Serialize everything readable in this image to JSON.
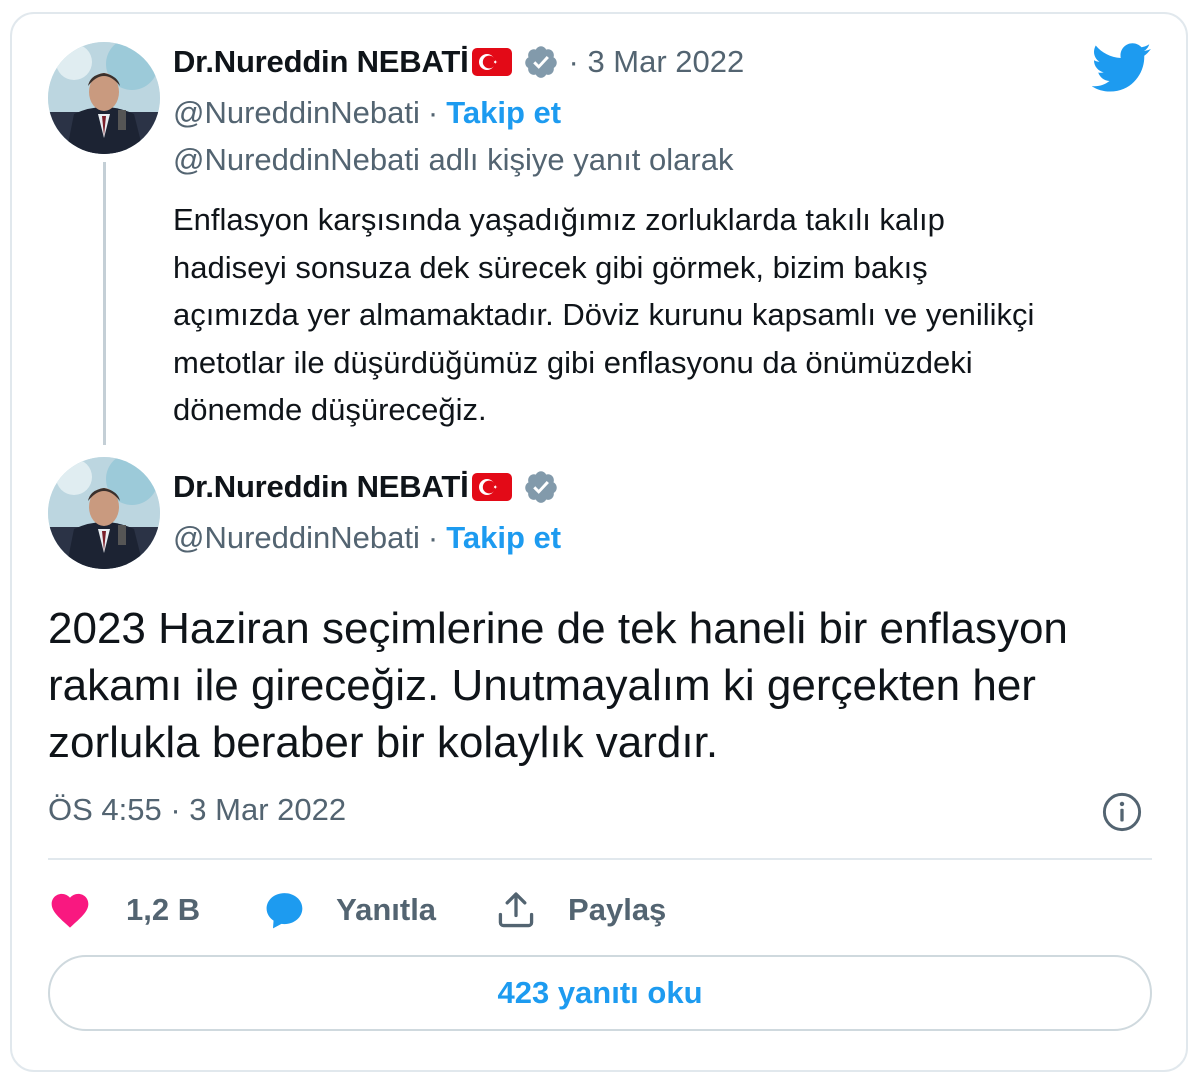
{
  "colors": {
    "accent": "#1d9bf0",
    "text_primary": "#0f1419",
    "text_secondary": "#536471",
    "like": "#f91880",
    "border": "#e1e8ed"
  },
  "icons": {
    "brand": "twitter-bird-icon",
    "flag": "turkey-flag-icon",
    "verified": "verified-badge-icon",
    "info": "info-icon",
    "like": "heart-icon",
    "reply": "chat-bubble-icon",
    "share": "share-upload-icon"
  },
  "parent_tweet": {
    "display_name": "Dr.Nureddin NEBATİ",
    "date": "· 3 Mar 2022",
    "handle": "@NureddinNebati",
    "separator": "·",
    "follow_label": "Takip et",
    "reply_context": "@NureddinNebati adlı kişiye yanıt olarak",
    "text_lines": [
      "Enflasyon karşısında yaşadığımız zorluklarda takılı kalıp",
      "hadiseyi sonsuza dek sürecek gibi görmek, bizim bakış",
      "açımızda yer almamaktadır. Döviz kurunu kapsamlı ve yenilikçi",
      "metotlar ile düşürdüğümüz gibi enflasyonu da önümüzdeki",
      "dönemde düşüreceğiz."
    ]
  },
  "main_tweet": {
    "display_name": "Dr.Nureddin NEBATİ",
    "handle": "@NureddinNebati",
    "separator": "·",
    "follow_label": "Takip et",
    "text_lines": [
      "2023 Haziran seçimlerine de tek haneli bir enflasyon",
      "rakamı ile gireceğiz. Unutmayalım ki gerçekten her",
      "zorlukla beraber bir kolaylık vardır."
    ],
    "timestamp": "ÖS 4:55 · 3 Mar 2022",
    "actions": {
      "like_count": "1,2 B",
      "reply_label": "Yanıtla",
      "share_label": "Paylaş"
    },
    "read_replies_label": "423 yanıtı oku"
  }
}
